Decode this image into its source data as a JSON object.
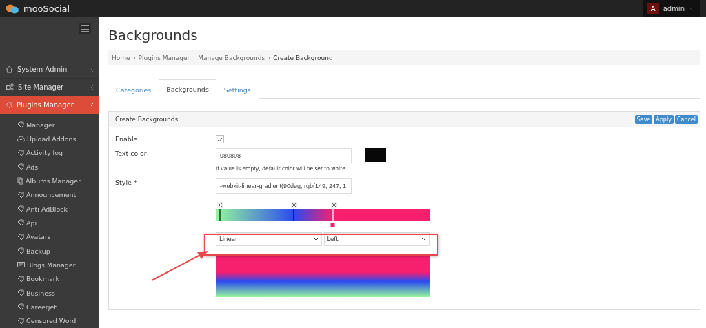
{
  "header": {
    "brand": "mooSocial",
    "user": {
      "initial": "A",
      "name": "admin"
    }
  },
  "sidebar": {
    "sections": [
      {
        "label": "System Admin",
        "kind": "home",
        "selected": false
      },
      {
        "label": "Site Manager",
        "kind": "gears",
        "selected": false
      },
      {
        "label": "Plugins Manager",
        "kind": "tag",
        "selected": true
      }
    ],
    "items": [
      {
        "label": "Manager",
        "kind": "tag"
      },
      {
        "label": "Upload Addons",
        "kind": "cloud"
      },
      {
        "label": "Activity log",
        "kind": "tag"
      },
      {
        "label": "Ads",
        "kind": "tag"
      },
      {
        "label": "Albums Manager",
        "kind": "albums"
      },
      {
        "label": "Announcement",
        "kind": "tag"
      },
      {
        "label": "Anti AdBlock",
        "kind": "tag"
      },
      {
        "label": "Api",
        "kind": "tag"
      },
      {
        "label": "Avatars",
        "kind": "tag"
      },
      {
        "label": "Backup",
        "kind": "tag"
      },
      {
        "label": "Blogs Manager",
        "kind": "blog"
      },
      {
        "label": "Bookmark",
        "kind": "tag"
      },
      {
        "label": "Business",
        "kind": "tag"
      },
      {
        "label": "Careerjet",
        "kind": "tag"
      },
      {
        "label": "Censored Word",
        "kind": "tag"
      }
    ]
  },
  "page": {
    "title": "Backgrounds",
    "breadcrumb": [
      "Home",
      "Plugins Manager",
      "Manage Backgrounds",
      "Create Background"
    ],
    "tabs": [
      {
        "label": "Categories",
        "selected": false
      },
      {
        "label": "Backgrounds",
        "selected": true
      },
      {
        "label": "Settings",
        "selected": false
      }
    ],
    "panel": {
      "title": "Create Backgrounds",
      "buttons": [
        "Save",
        "Apply",
        "Cancel"
      ],
      "fields": [
        {
          "kind": "checkbox",
          "label": "Enable",
          "checked": true
        },
        {
          "kind": "color",
          "label": "Text color",
          "value": "080808",
          "help": "If value is empty, default color will be set to white",
          "color": "#080808"
        },
        {
          "kind": "text",
          "label": "Style *",
          "value": "-webkit-linear-gradient(90deg, rgb(149, 247, 1"
        }
      ],
      "gradient": {
        "type": "Linear",
        "direction": "Left"
      }
    }
  }
}
